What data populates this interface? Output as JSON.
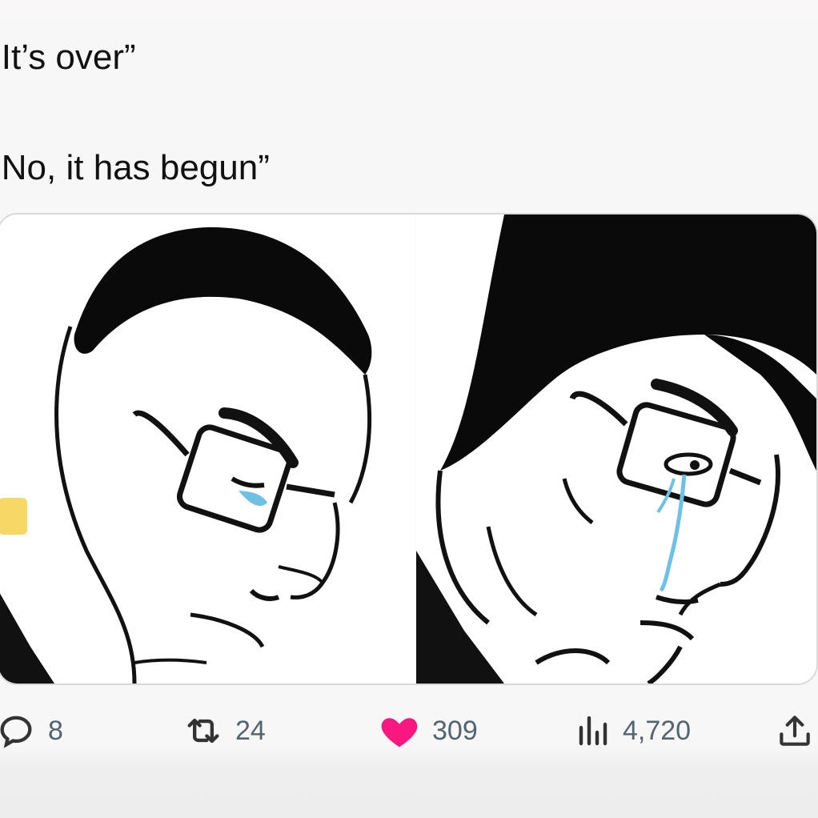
{
  "tweet": {
    "text_lines": [
      "’It’s over”",
      "’No, it has begun”"
    ]
  },
  "media": {
    "images": [
      {
        "name": "crying-wojak-left"
      },
      {
        "name": "crying-wojak-right"
      }
    ]
  },
  "actions": {
    "reply": {
      "icon": "reply-icon",
      "count": "8"
    },
    "retweet": {
      "icon": "retweet-icon",
      "count": "24"
    },
    "like": {
      "icon": "heart-icon",
      "count": "309",
      "color": "#f91880"
    },
    "views": {
      "icon": "views-icon",
      "count": "4,720"
    },
    "share": {
      "icon": "share-icon"
    }
  },
  "colors": {
    "text": "#111111",
    "muted": "#536471",
    "like": "#f91880",
    "tear": "#6ec1e4"
  }
}
